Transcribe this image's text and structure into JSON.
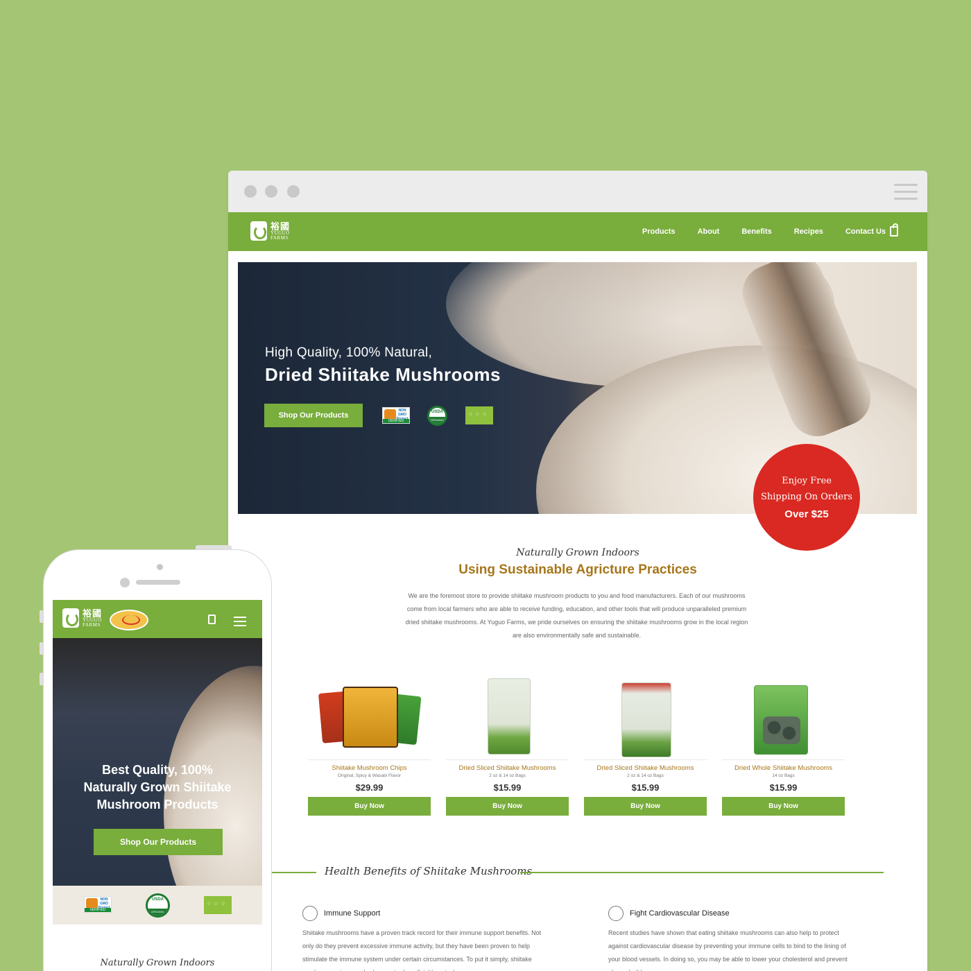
{
  "desktop": {
    "nav": {
      "logo_cn": "裕國",
      "logo_en_1": "YUGUO",
      "logo_en_2": "FARMS",
      "links": [
        "Products",
        "About",
        "Benefits",
        "Recipes",
        "Contact Us"
      ],
      "cart_icon": "shopping-bag-icon"
    },
    "hero": {
      "subtitle": "High Quality, 100% Natural,",
      "title": "Dried Shiitake Mushrooms",
      "cta": "Shop Our Products",
      "badges": [
        "non-gmo-verified-badge",
        "usda-organic-badge",
        "eu-organic-badge"
      ],
      "badge_text": {
        "nongmo": "NON GMO Project",
        "nongmo_verified": "VERIFIED",
        "usda": "USDA",
        "usda_organic": "ORGANIC"
      }
    },
    "shipping_badge": {
      "line1": "Enjoy Free",
      "line2": "Shipping On Orders",
      "line3": "Over $25"
    },
    "intro": {
      "script": "Naturally Grown Indoors",
      "heading": "Using Sustainable Agricture Practices",
      "body": "We are the foremost store to provide shiitake mushroom products to you and food manufacturers. Each of our mushrooms come from local farmers who are able to receive funding, education, and other tools that will produce unparalleled premium dried shiitake mushrooms. At Yuguo Farms, we pride ourselves on ensuring the shiitake mushrooms grow in the local region are also environmentally safe and sustainable."
    },
    "products": [
      {
        "name": "Shiitake Mushroom Chips",
        "desc": "Original, Spicy & Wasabi Flavor",
        "price": "$29.99",
        "cta": "Buy Now"
      },
      {
        "name": "Dried Sliced Shiitake Mushrooms",
        "desc": "2 oz & 14 oz Bags",
        "price": "$15.99",
        "cta": "Buy Now"
      },
      {
        "name": "Dried Sliced Shiitake Mushrooms",
        "desc": "2 oz & 14 oz Bags",
        "price": "$15.99",
        "cta": "Buy Now"
      },
      {
        "name": "Dried Whole Shiitake Mushrooms",
        "desc": "14 oz Bags",
        "price": "$15.99",
        "cta": "Buy Now"
      }
    ],
    "benefits": {
      "title": "Health Benefits of Shiitake Mushrooms",
      "items": [
        {
          "title": "Immune Support",
          "text": "Shiitake mushrooms have a proven track record for their immune support benefits. Not only do they prevent excessive immune activity, but they have been proven to help stimulate the immune system under certain circumstances. To put it simply, shiitake mushrooms give your body an extra beneficial boost when"
        },
        {
          "title": "Fight Cardiovascular Disease",
          "text": "Recent studies have shown that eating shiitake mushrooms can also help to protect against cardiovascular disease by preventing your immune cells to bind to the lining of your blood vessels. In doing so, you may be able to lower your cholesterol and prevent plaque build up."
        }
      ]
    }
  },
  "mobile": {
    "nav": {
      "logo_cn": "裕國",
      "logo_en_1": "YUGUO",
      "logo_en_2": "FARMS"
    },
    "hero": {
      "title_line1": "Best Quality, 100%",
      "title_line2": "Naturally Grown Shiitake",
      "title_line3": "Mushroom Products",
      "cta": "Shop Our Products"
    },
    "intro_script": "Naturally Grown Indoors"
  },
  "colors": {
    "background": "#a4c674",
    "brand_green": "#79ad3c",
    "accent_gold": "#a6761a",
    "shipping_red": "#d92922",
    "hero_dark": "#243246"
  }
}
